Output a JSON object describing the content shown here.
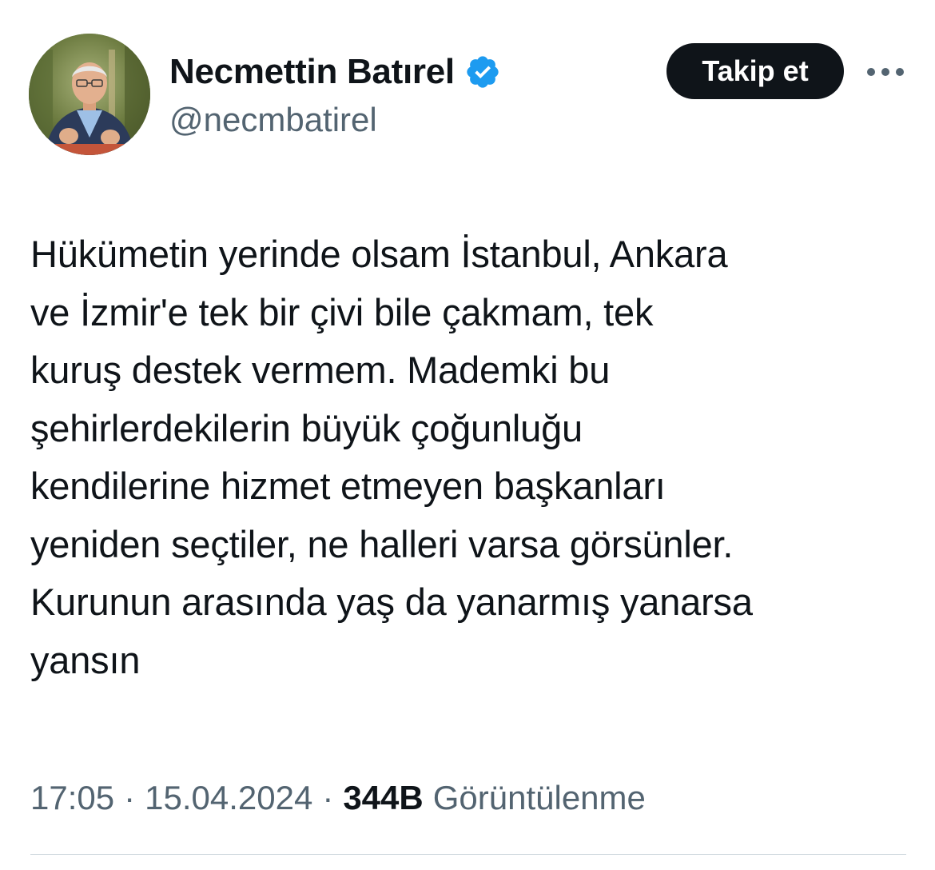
{
  "author": {
    "display_name": "Necmettin Batırel",
    "handle": "@necmbatirel",
    "verified": true
  },
  "actions": {
    "follow_label": "Takip et",
    "more_icon": "more-horizontal-icon"
  },
  "tweet": {
    "lines": [
      "Hükümetin yerinde olsam İstanbul, Ankara",
      "ve İzmir'e tek bir çivi bile çakmam, tek",
      "kuruş destek vermem. Mademki bu",
      "şehirlerdekilerin büyük çoğunluğu",
      "kendilerine hizmet etmeyen başkanları",
      "yeniden seçtiler, ne halleri varsa görsünler.",
      "Kurunun arasında yaş da yanarmış yanarsa",
      "yansın"
    ]
  },
  "meta": {
    "time": "17:05",
    "date": "15.04.2024",
    "views_count": "344B",
    "views_label": "Görüntülenme",
    "separator": "·"
  },
  "colors": {
    "verified_badge": "#1d9bf0",
    "text_primary": "#0f1419",
    "text_secondary": "#536471",
    "button_bg": "#0f1419"
  }
}
